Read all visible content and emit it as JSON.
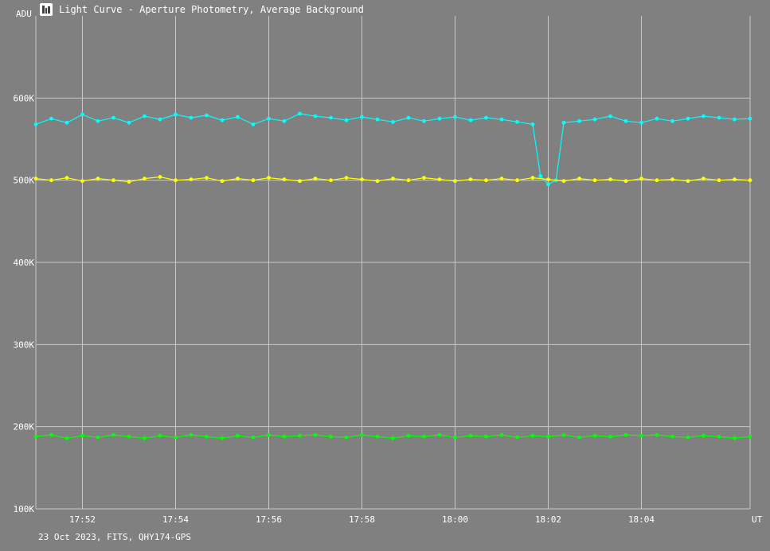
{
  "window": {
    "title": "Light Curve - Aperture Photometry, Average Background",
    "icon": "light-curve-app-icon"
  },
  "footer": {
    "caption": "23 Oct 2023, FITS, QHY174-GPS"
  },
  "chart_data": {
    "type": "line",
    "ylabel": "ADU",
    "xlabel": "UT",
    "ylim": [
      100000,
      700000
    ],
    "y_ticks": [
      {
        "value": 100000,
        "label": "100K"
      },
      {
        "value": 200000,
        "label": "200K"
      },
      {
        "value": 300000,
        "label": "300K"
      },
      {
        "value": 400000,
        "label": "400K"
      },
      {
        "value": 500000,
        "label": "500K"
      },
      {
        "value": 600000,
        "label": "600K"
      }
    ],
    "xlim": [
      "17:51:00",
      "18:06:20"
    ],
    "x_ticks": [
      {
        "value": "17:52",
        "label": "17:52"
      },
      {
        "value": "17:54",
        "label": "17:54"
      },
      {
        "value": "17:56",
        "label": "17:56"
      },
      {
        "value": "17:58",
        "label": "17:58"
      },
      {
        "value": "18:00",
        "label": "18:00"
      },
      {
        "value": "18:02",
        "label": "18:02"
      },
      {
        "value": "18:04",
        "label": "18:04"
      }
    ],
    "grid": true,
    "legend": "none",
    "background": "#808080",
    "grid_color": "#c8c8c8",
    "series": [
      {
        "color": "#00ffff",
        "points": [
          [
            "17:51:00",
            568000
          ],
          [
            "17:51:20",
            575000
          ],
          [
            "17:51:40",
            570000
          ],
          [
            "17:52:00",
            580000
          ],
          [
            "17:52:20",
            572000
          ],
          [
            "17:52:40",
            576000
          ],
          [
            "17:53:00",
            570000
          ],
          [
            "17:53:20",
            578000
          ],
          [
            "17:53:40",
            574000
          ],
          [
            "17:54:00",
            580000
          ],
          [
            "17:54:20",
            576000
          ],
          [
            "17:54:40",
            579000
          ],
          [
            "17:55:00",
            573000
          ],
          [
            "17:55:20",
            577000
          ],
          [
            "17:55:40",
            568000
          ],
          [
            "17:56:00",
            575000
          ],
          [
            "17:56:20",
            572000
          ],
          [
            "17:56:40",
            581000
          ],
          [
            "17:57:00",
            578000
          ],
          [
            "17:57:20",
            576000
          ],
          [
            "17:57:40",
            573000
          ],
          [
            "17:58:00",
            577000
          ],
          [
            "17:58:20",
            574000
          ],
          [
            "17:58:40",
            571000
          ],
          [
            "17:59:00",
            576000
          ],
          [
            "17:59:20",
            572000
          ],
          [
            "17:59:40",
            575000
          ],
          [
            "18:00:00",
            577000
          ],
          [
            "18:00:20",
            573000
          ],
          [
            "18:00:40",
            576000
          ],
          [
            "18:01:00",
            574000
          ],
          [
            "18:01:20",
            571000
          ],
          [
            "18:01:40",
            568000
          ],
          [
            "18:01:50",
            505000
          ],
          [
            "18:02:00",
            495000
          ],
          [
            "18:02:10",
            500000
          ],
          [
            "18:02:20",
            570000
          ],
          [
            "18:02:40",
            572000
          ],
          [
            "18:03:00",
            574000
          ],
          [
            "18:03:20",
            578000
          ],
          [
            "18:03:40",
            572000
          ],
          [
            "18:04:00",
            570000
          ],
          [
            "18:04:20",
            575000
          ],
          [
            "18:04:40",
            572000
          ],
          [
            "18:05:00",
            575000
          ],
          [
            "18:05:20",
            578000
          ],
          [
            "18:05:40",
            576000
          ],
          [
            "18:06:00",
            574000
          ],
          [
            "18:06:20",
            575000
          ]
        ]
      },
      {
        "color": "#ffff00",
        "points": [
          [
            "17:51:00",
            502000
          ],
          [
            "17:51:20",
            500000
          ],
          [
            "17:51:40",
            503000
          ],
          [
            "17:52:00",
            499000
          ],
          [
            "17:52:20",
            502000
          ],
          [
            "17:52:40",
            500000
          ],
          [
            "17:53:00",
            498000
          ],
          [
            "17:53:20",
            502000
          ],
          [
            "17:53:40",
            504000
          ],
          [
            "17:54:00",
            500000
          ],
          [
            "17:54:20",
            501000
          ],
          [
            "17:54:40",
            503000
          ],
          [
            "17:55:00",
            499000
          ],
          [
            "17:55:20",
            502000
          ],
          [
            "17:55:40",
            500000
          ],
          [
            "17:56:00",
            503000
          ],
          [
            "17:56:20",
            501000
          ],
          [
            "17:56:40",
            499000
          ],
          [
            "17:57:00",
            502000
          ],
          [
            "17:57:20",
            500000
          ],
          [
            "17:57:40",
            503000
          ],
          [
            "17:58:00",
            501000
          ],
          [
            "17:58:20",
            499000
          ],
          [
            "17:58:40",
            502000
          ],
          [
            "17:59:00",
            500000
          ],
          [
            "17:59:20",
            503000
          ],
          [
            "17:59:40",
            501000
          ],
          [
            "18:00:00",
            499000
          ],
          [
            "18:00:20",
            501000
          ],
          [
            "18:00:40",
            500000
          ],
          [
            "18:01:00",
            502000
          ],
          [
            "18:01:20",
            500000
          ],
          [
            "18:01:40",
            503000
          ],
          [
            "18:02:00",
            501000
          ],
          [
            "18:02:20",
            499000
          ],
          [
            "18:02:40",
            502000
          ],
          [
            "18:03:00",
            500000
          ],
          [
            "18:03:20",
            501000
          ],
          [
            "18:03:40",
            499000
          ],
          [
            "18:04:00",
            502000
          ],
          [
            "18:04:20",
            500000
          ],
          [
            "18:04:40",
            501000
          ],
          [
            "18:05:00",
            499000
          ],
          [
            "18:05:20",
            502000
          ],
          [
            "18:05:40",
            500000
          ],
          [
            "18:06:00",
            501000
          ],
          [
            "18:06:20",
            500000
          ]
        ]
      },
      {
        "color": "#00ff00",
        "points": [
          [
            "17:51:00",
            188000
          ],
          [
            "17:51:20",
            190000
          ],
          [
            "17:51:40",
            186000
          ],
          [
            "17:52:00",
            189000
          ],
          [
            "17:52:20",
            187000
          ],
          [
            "17:52:40",
            190000
          ],
          [
            "17:53:00",
            188000
          ],
          [
            "17:53:20",
            186000
          ],
          [
            "17:53:40",
            189000
          ],
          [
            "17:54:00",
            187000
          ],
          [
            "17:54:20",
            190000
          ],
          [
            "17:54:40",
            188000
          ],
          [
            "17:55:00",
            186000
          ],
          [
            "17:55:20",
            189000
          ],
          [
            "17:55:40",
            187000
          ],
          [
            "17:56:00",
            190000
          ],
          [
            "17:56:20",
            188000
          ],
          [
            "17:56:40",
            189000
          ],
          [
            "17:57:00",
            190000
          ],
          [
            "17:57:20",
            188000
          ],
          [
            "17:57:40",
            187000
          ],
          [
            "17:58:00",
            190000
          ],
          [
            "17:58:20",
            188000
          ],
          [
            "17:58:40",
            186000
          ],
          [
            "17:59:00",
            189000
          ],
          [
            "17:59:20",
            188000
          ],
          [
            "17:59:40",
            190000
          ],
          [
            "18:00:00",
            187000
          ],
          [
            "18:00:20",
            189000
          ],
          [
            "18:00:40",
            188000
          ],
          [
            "18:01:00",
            190000
          ],
          [
            "18:01:20",
            187000
          ],
          [
            "18:01:40",
            189000
          ],
          [
            "18:02:00",
            188000
          ],
          [
            "18:02:20",
            190000
          ],
          [
            "18:02:40",
            187000
          ],
          [
            "18:03:00",
            189000
          ],
          [
            "18:03:20",
            188000
          ],
          [
            "18:03:40",
            190000
          ],
          [
            "18:04:00",
            189000
          ],
          [
            "18:04:20",
            190000
          ],
          [
            "18:04:40",
            188000
          ],
          [
            "18:05:00",
            187000
          ],
          [
            "18:05:20",
            189000
          ],
          [
            "18:05:40",
            188000
          ],
          [
            "18:06:00",
            186000
          ],
          [
            "18:06:20",
            188000
          ]
        ]
      }
    ]
  }
}
